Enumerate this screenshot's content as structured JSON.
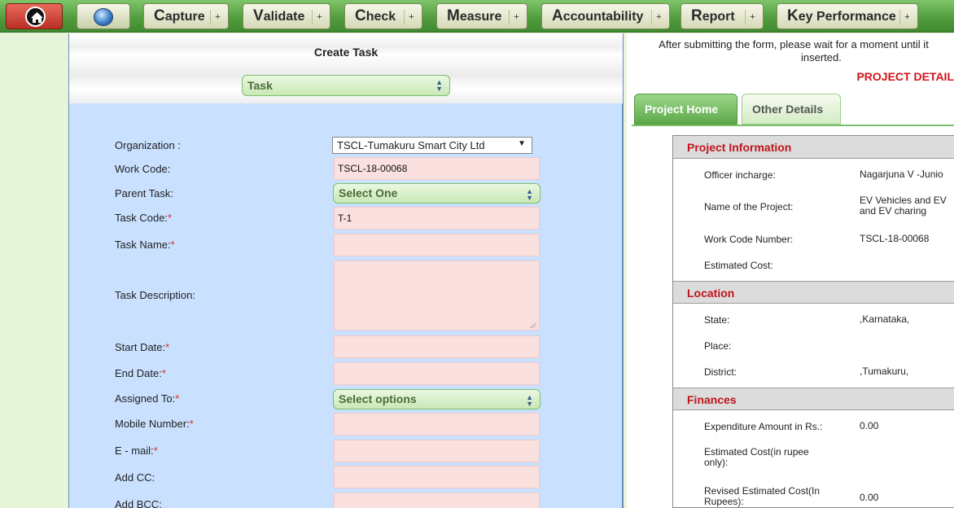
{
  "nav": {
    "items": [
      {
        "initial": "C",
        "rest": "apture"
      },
      {
        "initial": "V",
        "rest": "alidate"
      },
      {
        "initial": "C",
        "rest": "heck"
      },
      {
        "initial": "M",
        "rest": "easure"
      },
      {
        "initial": "A",
        "rest": "ccountability"
      },
      {
        "initial": "R",
        "rest": "eport"
      },
      {
        "initial": "K",
        "rest": "ey Performance"
      }
    ],
    "plus": "+"
  },
  "form": {
    "title": "Create Task",
    "type_select": "Task",
    "fields": {
      "organization_label": "Organization :",
      "organization_value": "TSCL-Tumakuru Smart City Ltd",
      "work_code_label": "Work Code:",
      "work_code_value": "TSCL-18-00068",
      "parent_task_label": "Parent Task:",
      "parent_task_value": "Select One",
      "task_code_label": "Task Code:",
      "task_code_value": "T-1",
      "task_name_label": "Task Name:",
      "task_desc_label": "Task Description:",
      "start_date_label": "Start Date:",
      "end_date_label": "End Date:",
      "assigned_to_label": "Assigned To:",
      "assigned_to_value": "Select options",
      "mobile_label": "Mobile Number:",
      "email_label": "E - mail:",
      "cc_label": "Add CC:",
      "bcc_label": "Add BCC:"
    },
    "required_mark": "*"
  },
  "right": {
    "notice_line1": "After submitting the form, please wait for a moment until it",
    "notice_line2": "inserted.",
    "project_detail": "PROJECT DETAIL",
    "tabs": {
      "home": "Project Home",
      "other": "Other Details"
    },
    "info_head": "Project Information",
    "info": {
      "officer_k": "Officer incharge:",
      "officer_v": "Nagarjuna V -Junio",
      "name_k": "Name of the Project:",
      "name_v1": "EV Vehicles and EV",
      "name_v2": "and EV charing",
      "workcode_k": "Work Code Number:",
      "workcode_v": "TSCL-18-00068",
      "estcost_k": "Estimated Cost:"
    },
    "loc_head": "Location",
    "loc": {
      "state_k": "State:",
      "state_v": ",Karnataka,",
      "place_k": "Place:",
      "district_k": "District:",
      "district_v": ",Tumakuru,"
    },
    "fin_head": "Finances",
    "fin": {
      "exp_k": "Expenditure Amount in Rs.:",
      "exp_v": "0.00",
      "est_k1": "Estimated Cost(in rupee",
      "est_k2": "only):",
      "rev_k1": "Revised Estimated Cost(In",
      "rev_k2": "Rupees):",
      "rev_v": "0.00"
    }
  }
}
